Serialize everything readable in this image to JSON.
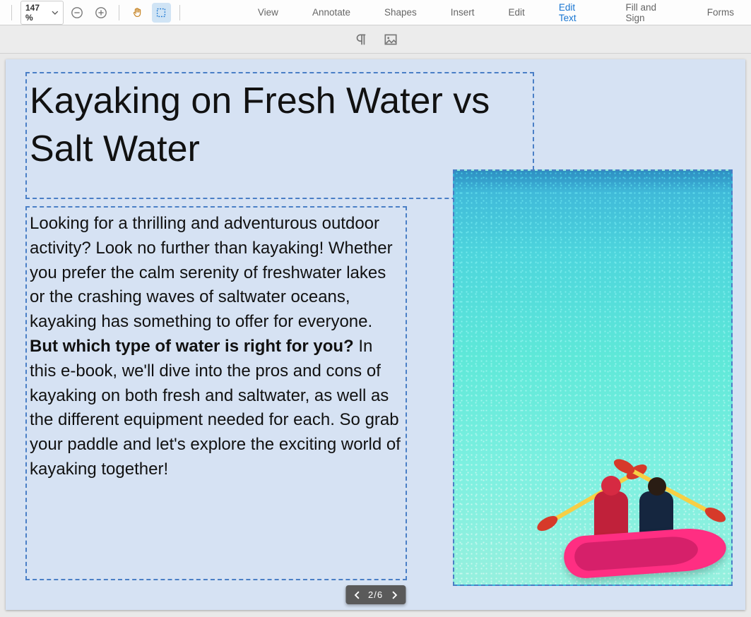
{
  "toolbar": {
    "zoom_level": "147 %",
    "menu": [
      {
        "label": "View",
        "active": false
      },
      {
        "label": "Annotate",
        "active": false
      },
      {
        "label": "Shapes",
        "active": false
      },
      {
        "label": "Insert",
        "active": false
      },
      {
        "label": "Edit",
        "active": false
      },
      {
        "label": "Edit Text",
        "active": true
      },
      {
        "label": "Fill and Sign",
        "active": false
      },
      {
        "label": "Forms",
        "active": false
      }
    ]
  },
  "document": {
    "title": "Kayaking on Fresh Water vs Salt Water",
    "body_before": "Looking for a thrilling and adventurous outdoor activity? Look no further than kayaking! Whether you prefer the calm serenity of freshwater lakes or the crashing waves of saltwater oceans, kayaking has something to offer for everyone. ",
    "body_bold": "But which type of water is right for you?",
    "body_after": " In this e-book, we'll dive into the pros and cons of kayaking on both fresh and saltwater, as well as the different equipment needed for each. So grab your paddle and let's explore the exciting world of kayaking together!",
    "image_alt": "Two people paddling a pink kayak on turquoise ocean water"
  },
  "pager": {
    "current": "2",
    "separator": "/",
    "total": "6"
  }
}
